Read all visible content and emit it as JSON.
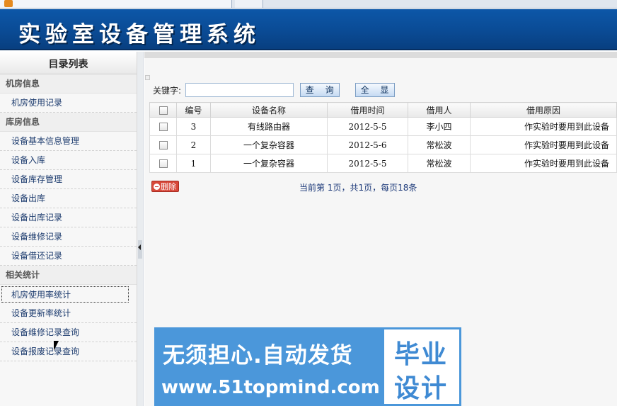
{
  "banner": {
    "title": "实验室设备管理系统"
  },
  "sidebar": {
    "header": "目录列表",
    "groups": [
      {
        "title": "机房信息",
        "items": [
          "机房使用记录"
        ]
      },
      {
        "title": "库房信息",
        "items": [
          "设备基本信息管理",
          "设备入库",
          "设备库存管理",
          "设备出库",
          "设备出库记录",
          "设备维修记录",
          "设备借还记录"
        ]
      },
      {
        "title": "相关统计",
        "items": [
          "机房使用率统计",
          "设备更新率统计",
          "设备维修记录查询",
          "设备报废记录查询"
        ]
      }
    ]
  },
  "search": {
    "label": "关键字:",
    "value": "",
    "query_label": "查 询",
    "showall_label": "全 显"
  },
  "table": {
    "headers": [
      "编号",
      "设备名称",
      "借用时间",
      "借用人",
      "借用原因"
    ],
    "rows": [
      {
        "id": "3",
        "name": "有线路由器",
        "date": "2012-5-5",
        "borrower": "李小四",
        "reason": "作实验时要用到此设备"
      },
      {
        "id": "2",
        "name": "一个复杂容器",
        "date": "2012-5-6",
        "borrower": "常松波",
        "reason": "作实验时要用到此设备"
      },
      {
        "id": "1",
        "name": "一个复杂容器",
        "date": "2012-5-5",
        "borrower": "常松波",
        "reason": "作实验时要用到此设备"
      }
    ]
  },
  "actions": {
    "delete_label": "删除"
  },
  "pager": {
    "text": "当前第 1页，共1页，每页18条"
  },
  "watermark": {
    "line1": "无须担心.自动发货",
    "line2": "www.51topmind.com",
    "badge1": "毕业",
    "badge2": "设计"
  },
  "colors": {
    "banner": "#0d57a8",
    "link": "#1c3b6e",
    "delete": "#d8483a",
    "watermark": "#4b97da"
  }
}
